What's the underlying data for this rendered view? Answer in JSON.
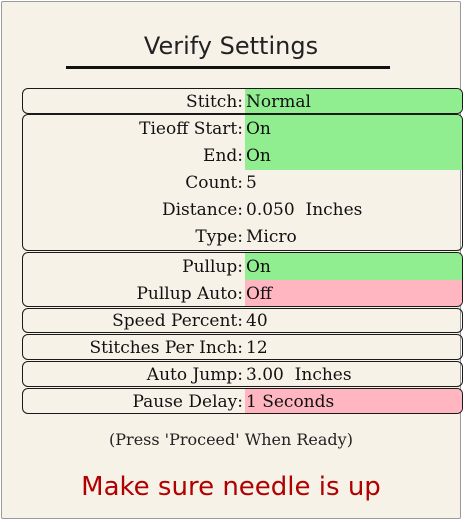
{
  "dialog": {
    "title": "Verify Settings",
    "prompt": "(Press 'Proceed' When Ready)",
    "warning": "Make sure needle is up"
  },
  "colors": {
    "on_highlight": "#90ee90",
    "off_highlight": "#ffb6c1",
    "warning_text": "#b00000"
  },
  "settings": {
    "stitch": {
      "label": "Stitch:",
      "value": "Normal"
    },
    "tieoff_start": {
      "label": "Tieoff Start:",
      "value": "On"
    },
    "tieoff_end": {
      "label": "End:",
      "value": "On"
    },
    "tieoff_count": {
      "label": "Count:",
      "value": "5"
    },
    "tieoff_distance": {
      "label": "Distance:",
      "value": "0.050  Inches"
    },
    "tieoff_type": {
      "label": "Type:",
      "value": "Micro"
    },
    "pullup": {
      "label": "Pullup:",
      "value": "On"
    },
    "pullup_auto": {
      "label": "Pullup Auto:",
      "value": "Off"
    },
    "speed_percent": {
      "label": "Speed Percent:",
      "value": "40"
    },
    "stitches_per_inch": {
      "label": "Stitches Per Inch:",
      "value": "12"
    },
    "auto_jump": {
      "label": "Auto Jump:",
      "value": "3.00  Inches"
    },
    "pause_delay": {
      "label": "Pause Delay:",
      "value": "1 Seconds"
    }
  }
}
